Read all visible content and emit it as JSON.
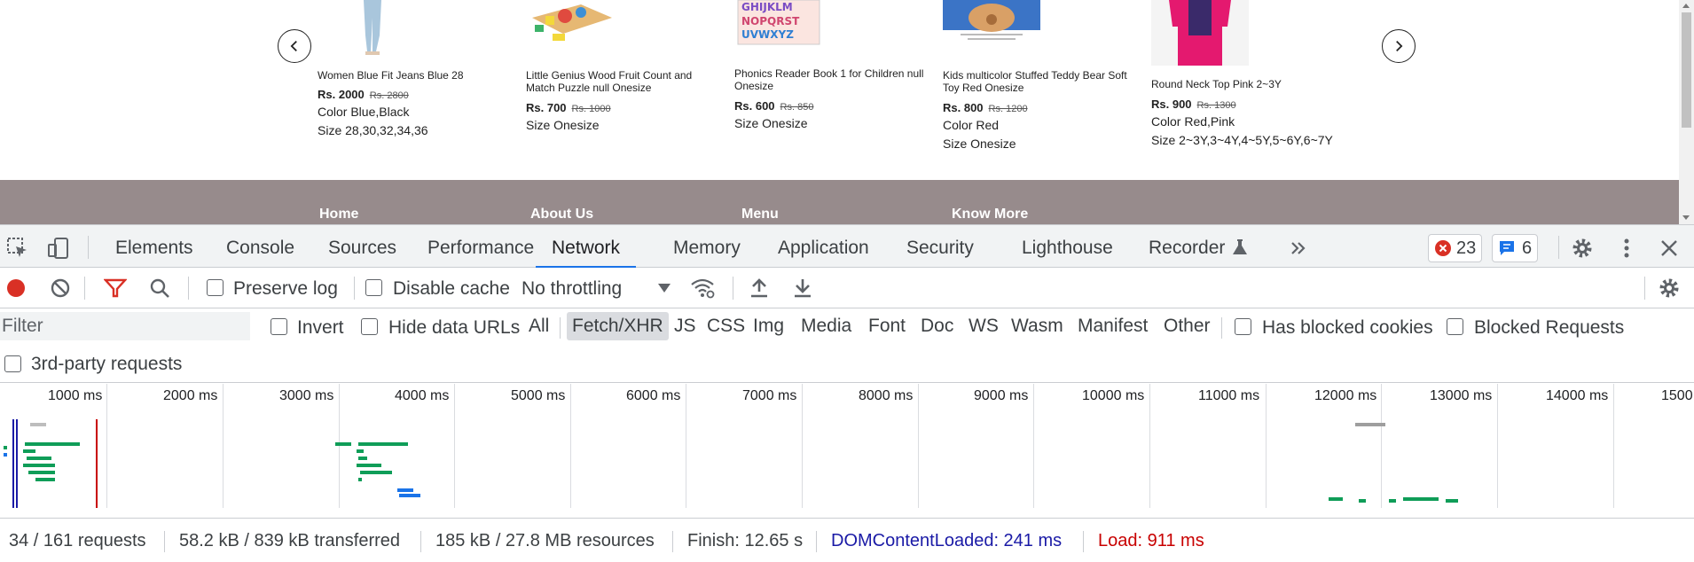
{
  "products": [
    {
      "name": "Women Blue Fit Jeans Blue 28",
      "price": "Rs. 2000",
      "old_price": "Rs. 2800",
      "attrs": [
        "Color Blue,Black",
        "Size 28,30,32,34,36"
      ]
    },
    {
      "name": "Little Genius Wood Fruit Count and Match Puzzle null Onesize",
      "price": "Rs. 700",
      "old_price": "Rs. 1000",
      "attrs": [
        "Size Onesize"
      ]
    },
    {
      "name": "Phonics Reader Book 1 for Children null Onesize",
      "price": "Rs. 600",
      "old_price": "Rs. 850",
      "attrs": [
        "Size Onesize"
      ]
    },
    {
      "name": "Kids multicolor Stuffed Teddy Bear Soft Toy Red Onesize",
      "price": "Rs. 800",
      "old_price": "Rs. 1200",
      "attrs": [
        "Color Red",
        "Size Onesize"
      ]
    },
    {
      "name": "Round Neck Top Pink 2~3Y",
      "price": "Rs. 900",
      "old_price": "Rs. 1300",
      "attrs": [
        "Color Red,Pink",
        "Size 2~3Y,3~4Y,4~5Y,5~6Y,6~7Y"
      ]
    }
  ],
  "footer_links": [
    "Home",
    "About Us",
    "Menu",
    "Know More"
  ],
  "devtools": {
    "tabs": [
      "Elements",
      "Console",
      "Sources",
      "Performance",
      "Network",
      "Memory",
      "Application",
      "Security",
      "Lighthouse",
      "Recorder"
    ],
    "active_tab": "Network",
    "errors_count": "23",
    "messages_count": "6",
    "toolbar": {
      "preserve_log": "Preserve log",
      "disable_cache": "Disable cache",
      "throttling": "No throttling"
    },
    "filter": {
      "placeholder": "Filter",
      "invert": "Invert",
      "hide_data_urls": "Hide data URLs",
      "types": [
        "All",
        "Fetch/XHR",
        "JS",
        "CSS",
        "Img",
        "Media",
        "Font",
        "Doc",
        "WS",
        "Wasm",
        "Manifest",
        "Other"
      ],
      "active_type": "Fetch/XHR",
      "has_blocked_cookies": "Has blocked cookies",
      "blocked_requests": "Blocked Requests",
      "third_party": "3rd-party requests"
    },
    "timeline_ticks": [
      "1000 ms",
      "2000 ms",
      "3000 ms",
      "4000 ms",
      "5000 ms",
      "6000 ms",
      "7000 ms",
      "8000 ms",
      "9000 ms",
      "10000 ms",
      "11000 ms",
      "12000 ms",
      "13000 ms",
      "14000 ms",
      "1500"
    ],
    "status": {
      "requests": "34 / 161 requests",
      "transferred": "58.2 kB / 839 kB transferred",
      "resources": "185 kB / 27.8 MB resources",
      "finish": "Finish: 12.65 s",
      "dom_content_loaded": "DOMContentLoaded: 241 ms",
      "load": "Load: 911 ms"
    },
    "colors": {
      "accent": "#1a73e8",
      "error": "#d93025",
      "waterfall_green": "#0f9d58",
      "waterfall_blue": "#1a73e8"
    }
  }
}
